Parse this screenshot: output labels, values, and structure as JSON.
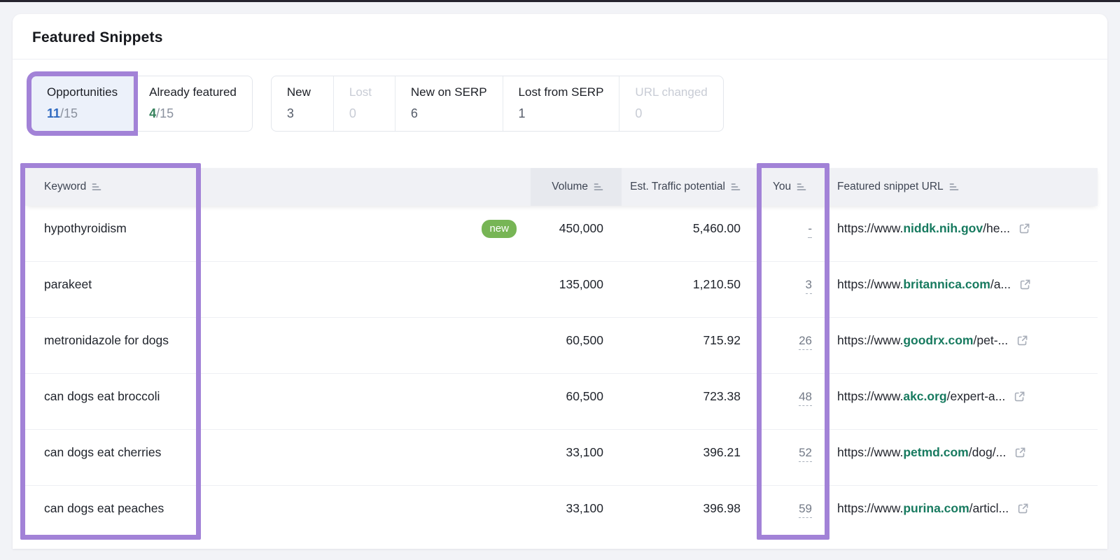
{
  "page": {
    "title": "Featured Snippets"
  },
  "tabs": {
    "opportunities": {
      "label": "Opportunities",
      "count": "11",
      "total": "/15"
    },
    "already_featured": {
      "label": "Already featured",
      "count": "4",
      "total": "/15"
    }
  },
  "filters": {
    "new": {
      "label": "New",
      "count": "3"
    },
    "lost": {
      "label": "Lost",
      "count": "0"
    },
    "new_on_serp": {
      "label": "New on SERP",
      "count": "6"
    },
    "lost_from_serp": {
      "label": "Lost from SERP",
      "count": "1"
    },
    "url_changed": {
      "label": "URL changed",
      "count": "0"
    }
  },
  "table": {
    "headers": {
      "keyword": "Keyword",
      "volume": "Volume",
      "traffic": "Est. Traffic potential",
      "you": "You",
      "url": "Featured snippet URL"
    },
    "rows": [
      {
        "keyword": "hypothyroidism",
        "badge": "new",
        "volume": "450,000",
        "traffic": "5,460.00",
        "you": "-",
        "url_prefix": "https://www.",
        "url_domain": "niddk.nih.gov",
        "url_path": "/he..."
      },
      {
        "keyword": "parakeet",
        "badge": "",
        "volume": "135,000",
        "traffic": "1,210.50",
        "you": "3",
        "url_prefix": "https://www.",
        "url_domain": "britannica.com",
        "url_path": "/a..."
      },
      {
        "keyword": "metronidazole for dogs",
        "badge": "",
        "volume": "60,500",
        "traffic": "715.92",
        "you": "26",
        "url_prefix": "https://www.",
        "url_domain": "goodrx.com",
        "url_path": "/pet-..."
      },
      {
        "keyword": "can dogs eat broccoli",
        "badge": "",
        "volume": "60,500",
        "traffic": "723.38",
        "you": "48",
        "url_prefix": "https://www.",
        "url_domain": "akc.org",
        "url_path": "/expert-a..."
      },
      {
        "keyword": "can dogs eat cherries",
        "badge": "",
        "volume": "33,100",
        "traffic": "396.21",
        "you": "52",
        "url_prefix": "https://www.",
        "url_domain": "petmd.com",
        "url_path": "/dog/..."
      },
      {
        "keyword": "can dogs eat peaches",
        "badge": "",
        "volume": "33,100",
        "traffic": "396.98",
        "you": "59",
        "url_prefix": "https://www.",
        "url_domain": "purina.com",
        "url_path": "/articl..."
      }
    ]
  },
  "colors": {
    "annotation_purple": "#a282d7",
    "selected_tab_bg": "#ecf1fa",
    "count_blue": "#2f6ac0",
    "count_green": "#35815b",
    "badge_green": "#77b555",
    "domain_green": "#177a5f",
    "header_bg": "#f0f1f5",
    "sorted_header_bg": "#e7e9ee"
  },
  "icons": {
    "sort": "sort-icon",
    "external_link": "external-link-icon"
  }
}
